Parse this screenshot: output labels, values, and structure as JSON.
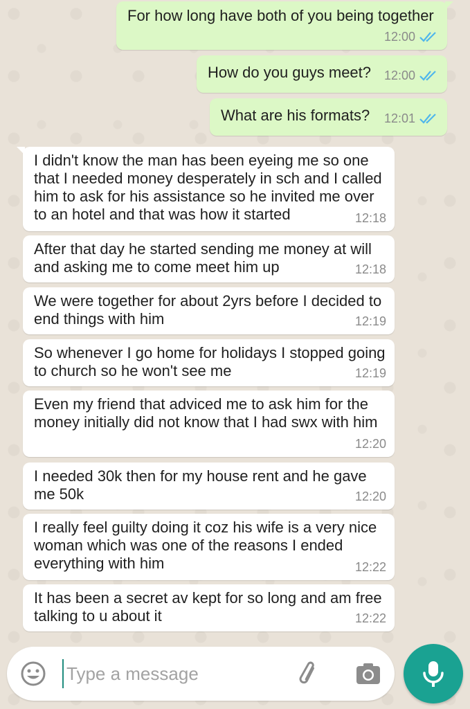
{
  "conversation": {
    "outgoing": [
      {
        "text": "For how long have both of you being together",
        "time": "12:00"
      },
      {
        "text": "How do you guys meet?",
        "time": "12:00"
      },
      {
        "text": "What are his formats?",
        "time": "12:01"
      }
    ],
    "incoming": [
      {
        "text": "I didn't know the man has been eyeing me so one that I needed money desperately in sch and I called him to ask for his assistance so he invited me over to an hotel and that was how it started",
        "time": "12:18"
      },
      {
        "text": "After that day he started sending me money at will and asking me to come meet him up",
        "time": "12:18"
      },
      {
        "text": "We were together for about 2yrs before I decided to end things with him",
        "time": "12:19"
      },
      {
        "text": "So whenever I go home for holidays I stopped going to church so he won't see me",
        "time": "12:19"
      },
      {
        "text": "Even my friend that adviced me to ask him for the money initially did not know that I had swx with him",
        "time": "12:20"
      },
      {
        "text": "I needed 30k then for my house rent and he gave me 50k",
        "time": "12:20"
      },
      {
        "text": "I really feel guilty doing it coz his wife is a very nice woman which was one of the reasons I ended everything with him",
        "time": "12:22"
      },
      {
        "text": "It has been a secret av kept for so long and am free talking to u about it",
        "time": "12:22"
      }
    ]
  },
  "composer": {
    "placeholder": "Type a message",
    "emoji_icon": "emoji-icon",
    "attach_icon": "paperclip-icon",
    "camera_icon": "camera-icon",
    "mic_icon": "microphone-icon"
  },
  "colors": {
    "outgoing_bubble": "#dcf8c6",
    "incoming_bubble": "#ffffff",
    "read_ticks": "#4fb6ec",
    "accent": "#1aa292"
  }
}
